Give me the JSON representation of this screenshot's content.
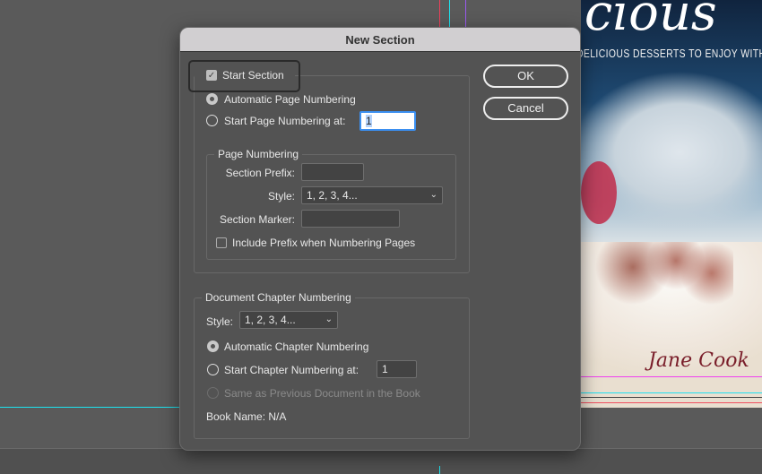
{
  "dialog": {
    "title": "New Section",
    "start_section": {
      "label": "Start Section",
      "checked": true
    },
    "auto_page_numbering": {
      "label": "Automatic Page Numbering",
      "selected": true
    },
    "start_page_numbering": {
      "label": "Start Page Numbering at:",
      "value": "1",
      "selected": false
    },
    "page_numbering": {
      "legend": "Page Numbering",
      "section_prefix_label": "Section Prefix:",
      "section_prefix_value": "",
      "style_label": "Style:",
      "style_value": "1, 2, 3, 4...",
      "section_marker_label": "Section Marker:",
      "section_marker_value": "",
      "include_prefix": {
        "label": "Include Prefix when Numbering Pages",
        "checked": false
      }
    },
    "chapter_numbering": {
      "legend": "Document Chapter Numbering",
      "style_label": "Style:",
      "style_value": "1, 2, 3, 4...",
      "automatic": {
        "label": "Automatic Chapter Numbering",
        "selected": true
      },
      "start_at": {
        "label": "Start Chapter Numbering at:",
        "value": "1"
      },
      "same_as_previous": {
        "label": "Same as Previous Document in the Book",
        "enabled": false
      },
      "book_name": "Book Name: N/A"
    },
    "ok_label": "OK",
    "cancel_label": "Cancel"
  },
  "cover": {
    "title": "Delicious",
    "subtitle": "DELICIOUS DESSERTS TO ENJOY WITH FRIENDS",
    "author": "Jane Cook"
  },
  "icons": {
    "checkmark": "✓",
    "chevron": "⌄"
  }
}
